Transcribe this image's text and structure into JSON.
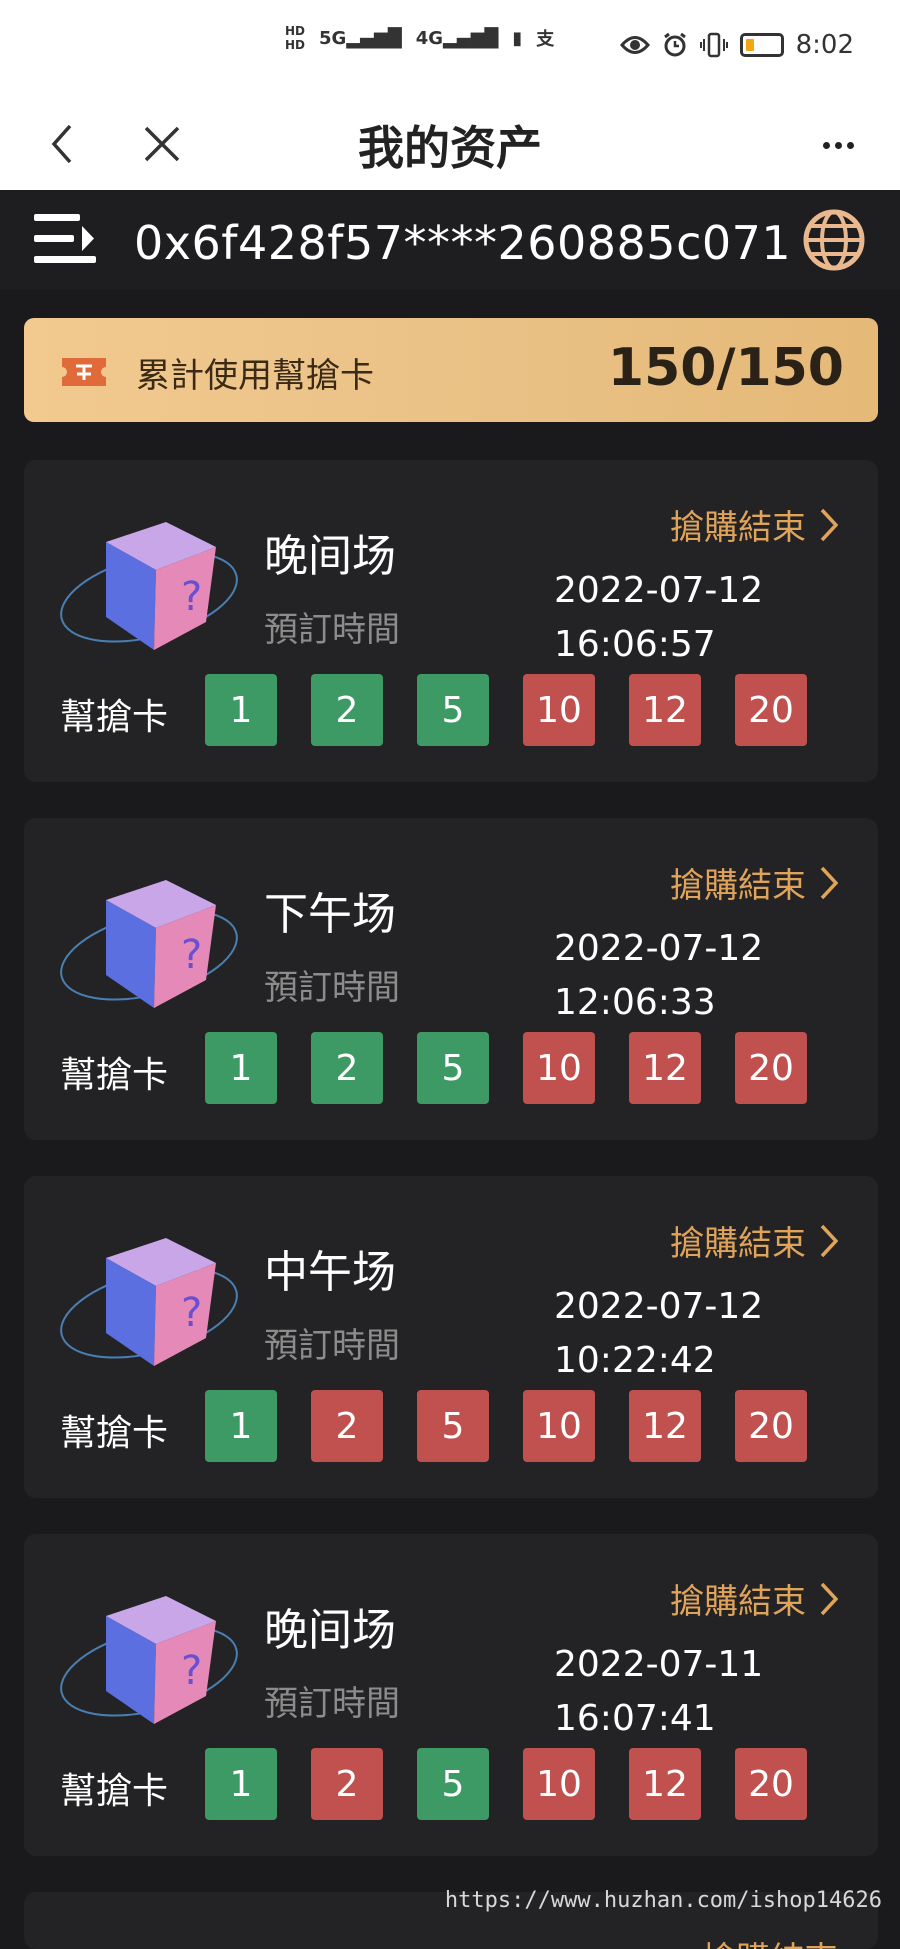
{
  "status_bar": {
    "network_labels": [
      "HD",
      "5G",
      "4G"
    ],
    "time": "8:02"
  },
  "nav": {
    "title": "我的资产"
  },
  "wallet": {
    "address": "0x6f428f57****260885c071"
  },
  "banner": {
    "label": "累計使用幫搶卡",
    "value": "150/150"
  },
  "sessions": [
    {
      "name": "晚间场",
      "order_label": "預訂時間",
      "status": "搶購結束",
      "date": "2022-07-12",
      "time": "16:06:57",
      "card_label": "幫搶卡",
      "chips": [
        {
          "value": "1",
          "state": "green"
        },
        {
          "value": "2",
          "state": "green"
        },
        {
          "value": "5",
          "state": "green"
        },
        {
          "value": "10",
          "state": "red"
        },
        {
          "value": "12",
          "state": "red"
        },
        {
          "value": "20",
          "state": "red"
        }
      ]
    },
    {
      "name": "下午场",
      "order_label": "預訂時間",
      "status": "搶購結束",
      "date": "2022-07-12",
      "time": "12:06:33",
      "card_label": "幫搶卡",
      "chips": [
        {
          "value": "1",
          "state": "green"
        },
        {
          "value": "2",
          "state": "green"
        },
        {
          "value": "5",
          "state": "green"
        },
        {
          "value": "10",
          "state": "red"
        },
        {
          "value": "12",
          "state": "red"
        },
        {
          "value": "20",
          "state": "red"
        }
      ]
    },
    {
      "name": "中午场",
      "order_label": "預訂時間",
      "status": "搶購結束",
      "date": "2022-07-12",
      "time": "10:22:42",
      "card_label": "幫搶卡",
      "chips": [
        {
          "value": "1",
          "state": "green"
        },
        {
          "value": "2",
          "state": "red"
        },
        {
          "value": "5",
          "state": "red"
        },
        {
          "value": "10",
          "state": "red"
        },
        {
          "value": "12",
          "state": "red"
        },
        {
          "value": "20",
          "state": "red"
        }
      ]
    },
    {
      "name": "晚间场",
      "order_label": "預訂時間",
      "status": "搶購結束",
      "date": "2022-07-11",
      "time": "16:07:41",
      "card_label": "幫搶卡",
      "chips": [
        {
          "value": "1",
          "state": "green"
        },
        {
          "value": "2",
          "state": "red"
        },
        {
          "value": "5",
          "state": "green"
        },
        {
          "value": "10",
          "state": "red"
        },
        {
          "value": "12",
          "state": "red"
        },
        {
          "value": "20",
          "state": "red"
        }
      ]
    }
  ],
  "partial_session": {
    "status": "搶購結束"
  },
  "watermark": "https://www.huzhan.com/ishop14626",
  "colors": {
    "background": "#1a1a1c",
    "card": "#232325",
    "accent": "#e0a35a",
    "chip_green": "#3d9a65",
    "chip_red": "#c0514f",
    "banner": "#e9c186"
  }
}
